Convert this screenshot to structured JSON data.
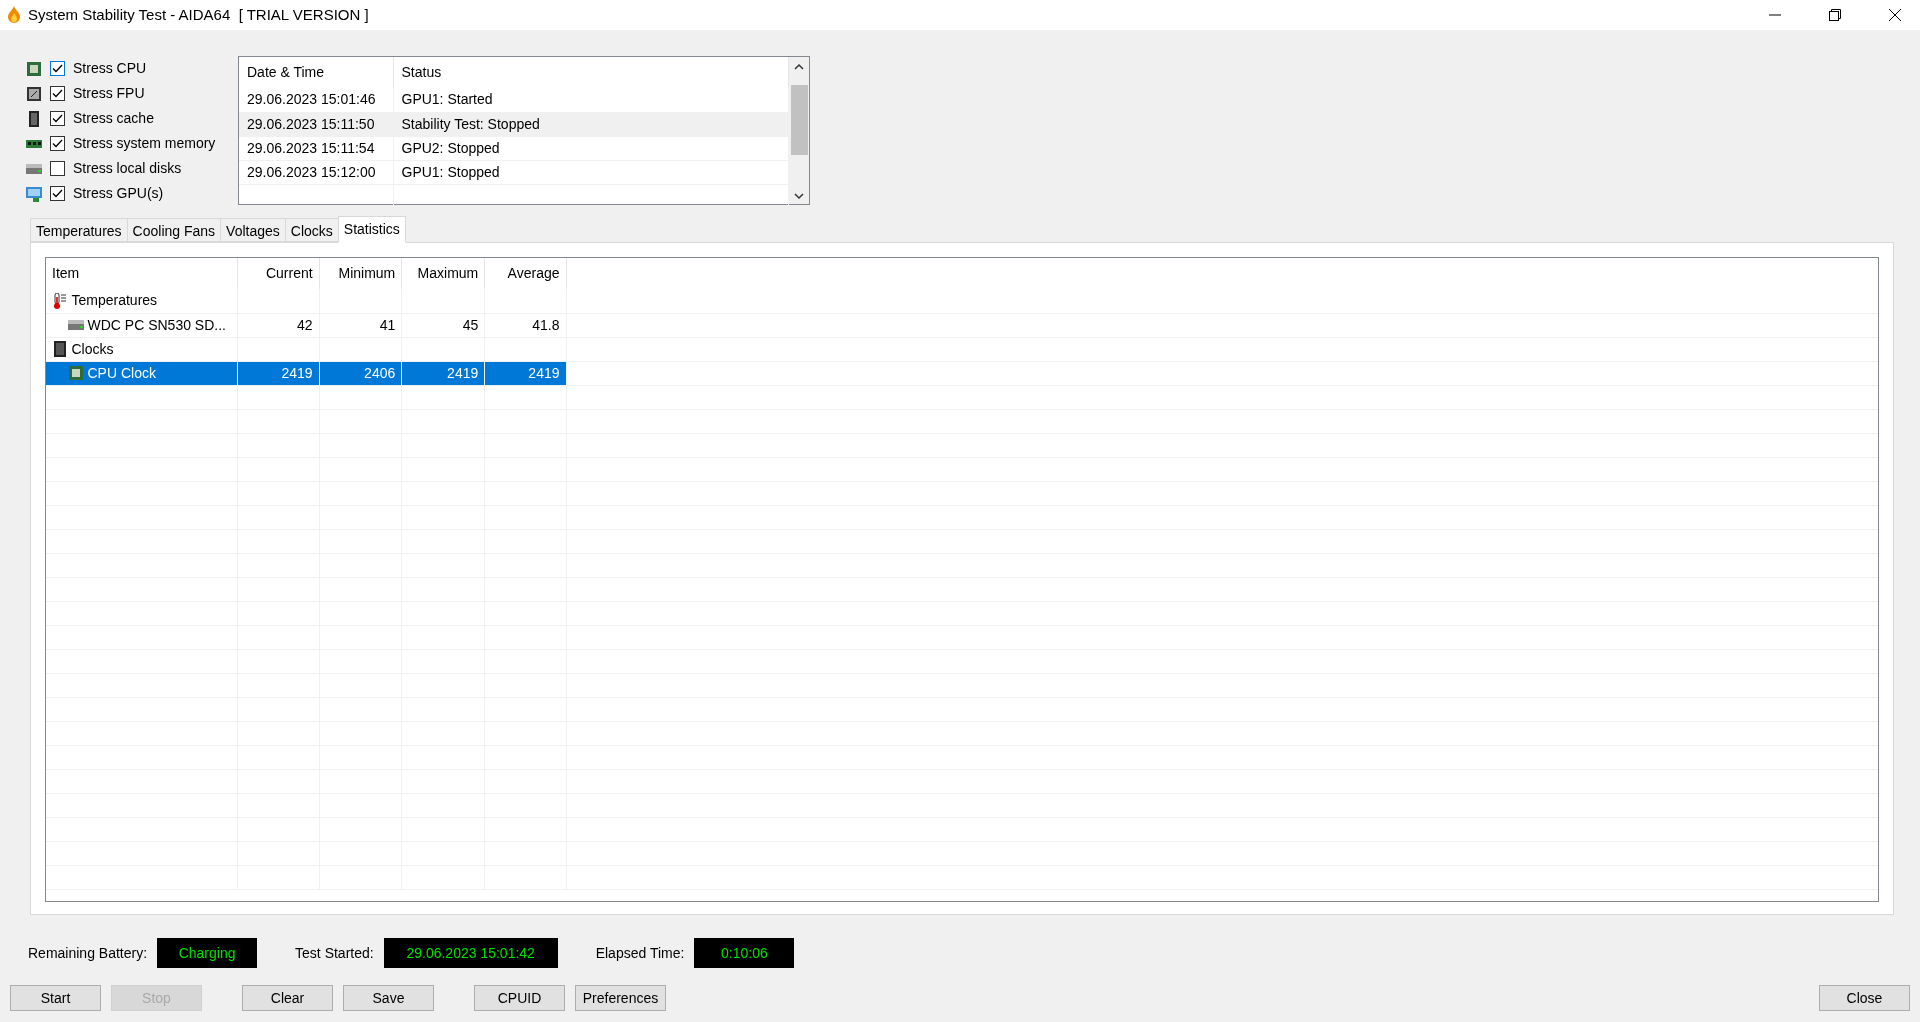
{
  "window": {
    "title": "System Stability Test - AIDA64  [ TRIAL VERSION ]"
  },
  "stress_options": [
    {
      "label": "Stress CPU",
      "checked": true,
      "kind": "cpu"
    },
    {
      "label": "Stress FPU",
      "checked": true,
      "kind": "fpu"
    },
    {
      "label": "Stress cache",
      "checked": true,
      "kind": "cache"
    },
    {
      "label": "Stress system memory",
      "checked": true,
      "kind": "memory"
    },
    {
      "label": "Stress local disks",
      "checked": false,
      "kind": "disk"
    },
    {
      "label": "Stress GPU(s)",
      "checked": true,
      "kind": "gpu"
    }
  ],
  "log": {
    "columns": [
      "Date & Time",
      "Status"
    ],
    "rows": [
      {
        "date_time": "29.06.2023 15:01:46",
        "status": "GPU1: Started",
        "selected": false
      },
      {
        "date_time": "29.06.2023 15:11:50",
        "status": "Stability Test: Stopped",
        "selected": true
      },
      {
        "date_time": "29.06.2023 15:11:54",
        "status": "GPU2: Stopped",
        "selected": false
      },
      {
        "date_time": "29.06.2023 15:12:00",
        "status": "GPU1: Stopped",
        "selected": false
      }
    ]
  },
  "tabs": [
    {
      "label": "Temperatures",
      "selected": false
    },
    {
      "label": "Cooling Fans",
      "selected": false
    },
    {
      "label": "Voltages",
      "selected": false
    },
    {
      "label": "Clocks",
      "selected": false
    },
    {
      "label": "Statistics",
      "selected": true
    }
  ],
  "statistics": {
    "columns": [
      "Item",
      "Current",
      "Minimum",
      "Maximum",
      "Average"
    ],
    "groups": [
      {
        "label": "Temperatures",
        "kind": "temperature",
        "children": [
          {
            "label": "WDC PC SN530 SD...",
            "kind": "disk",
            "values": [
              "42",
              "41",
              "45",
              "41.8"
            ],
            "selected": false
          }
        ]
      },
      {
        "label": "Clocks",
        "kind": "clock",
        "children": [
          {
            "label": "CPU Clock",
            "kind": "cpu",
            "values": [
              "2419",
              "2406",
              "2419",
              "2419"
            ],
            "selected": true
          }
        ]
      }
    ]
  },
  "status": [
    {
      "label": "Remaining Battery:",
      "value": "Charging"
    },
    {
      "label": "Test Started:",
      "value": "29.06.2023 15:01:42"
    },
    {
      "label": "Elapsed Time:",
      "value": "0:10:06"
    }
  ],
  "buttons": [
    {
      "label": "Start",
      "disabled": false
    },
    {
      "label": "Stop",
      "disabled": true
    },
    {
      "label": "Clear",
      "disabled": false
    },
    {
      "label": "Save",
      "disabled": false
    },
    {
      "label": "CPUID",
      "disabled": false
    },
    {
      "label": "Preferences",
      "disabled": false
    }
  ],
  "close_button": {
    "label": "Close",
    "disabled": false
  }
}
